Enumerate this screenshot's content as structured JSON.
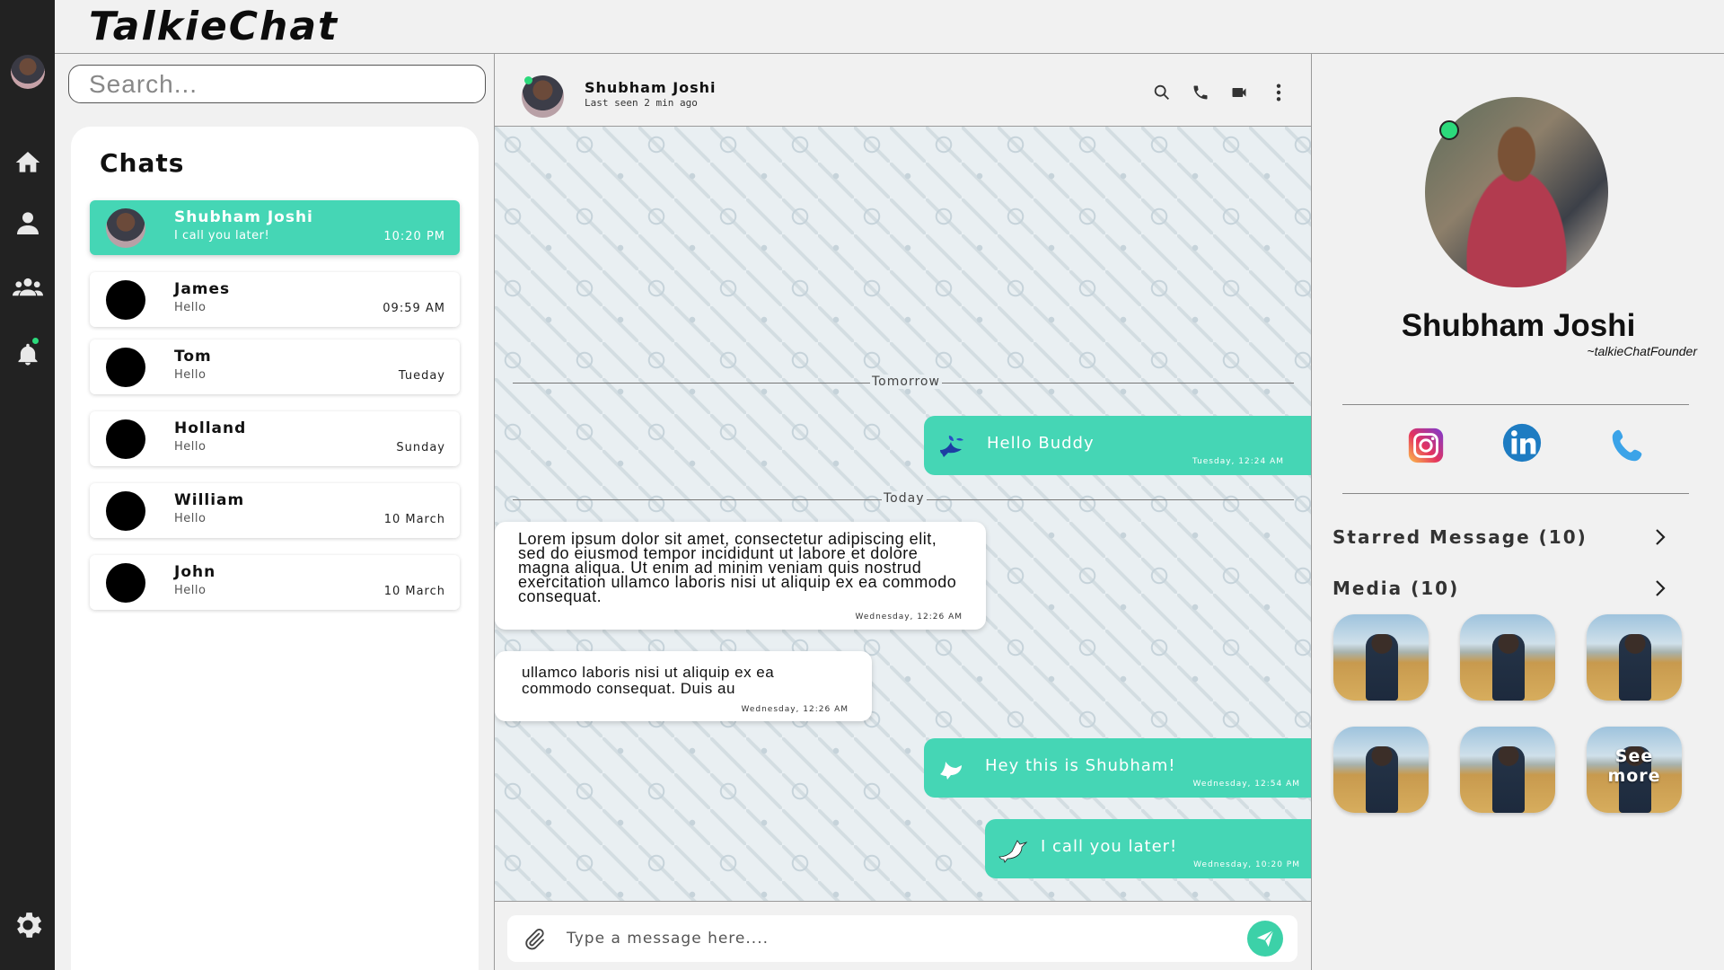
{
  "app": {
    "title": "TalkieChat"
  },
  "search": {
    "placeholder": "Search..."
  },
  "chats": {
    "heading": "Chats",
    "items": [
      {
        "name": "Shubham Joshi",
        "message": "I call you later!",
        "time": "10:20 PM",
        "active": true
      },
      {
        "name": "James",
        "message": "Hello",
        "time": "09:59 AM"
      },
      {
        "name": "Tom",
        "message": "Hello",
        "time": "Tueday"
      },
      {
        "name": "Holland",
        "message": "Hello",
        "time": "Sunday"
      },
      {
        "name": "William",
        "message": "Hello",
        "time": "10 March"
      },
      {
        "name": "John",
        "message": "Hello",
        "time": "10 March"
      }
    ]
  },
  "conversation": {
    "contact_name": "Shubham Joshi",
    "contact_status": "Last seen 2 min ago",
    "dividers": [
      "Tomorrow",
      "Today"
    ],
    "messages": [
      {
        "direction": "out",
        "text": "Hello Buddy",
        "time": "Tuesday, 12:24 AM"
      },
      {
        "direction": "in",
        "text": "Lorem ipsum dolor sit amet, consectetur adipiscing elit, sed do eiusmod tempor incididunt ut labore et dolore magna aliqua. Ut enim ad minim veniam quis nostrud exercitation ullamco laboris nisi ut aliquip ex ea commodo consequat.",
        "time": "Wednesday, 12:26 AM"
      },
      {
        "direction": "in",
        "text": "ullamco laboris nisi ut aliquip ex ea commodo consequat. Duis au",
        "time": "Wednesday, 12:26 AM"
      },
      {
        "direction": "out",
        "text": "Hey this is Shubham!",
        "time": "Wednesday, 12:54 AM"
      },
      {
        "direction": "out",
        "text": "I call you later!",
        "time": "Wednesday, 10:20 PM"
      }
    ],
    "composer_placeholder": "Type a message here...."
  },
  "profile": {
    "name": "Shubham Joshi",
    "tagline": "~talkieChatFounder",
    "starred_label": "Starred Message (10)",
    "media_label": "Media (10)",
    "see_more_line1": "See",
    "see_more_line2": "more"
  },
  "colors": {
    "accent": "#45d6b5",
    "rail": "#222222",
    "online": "#2bd97b"
  }
}
